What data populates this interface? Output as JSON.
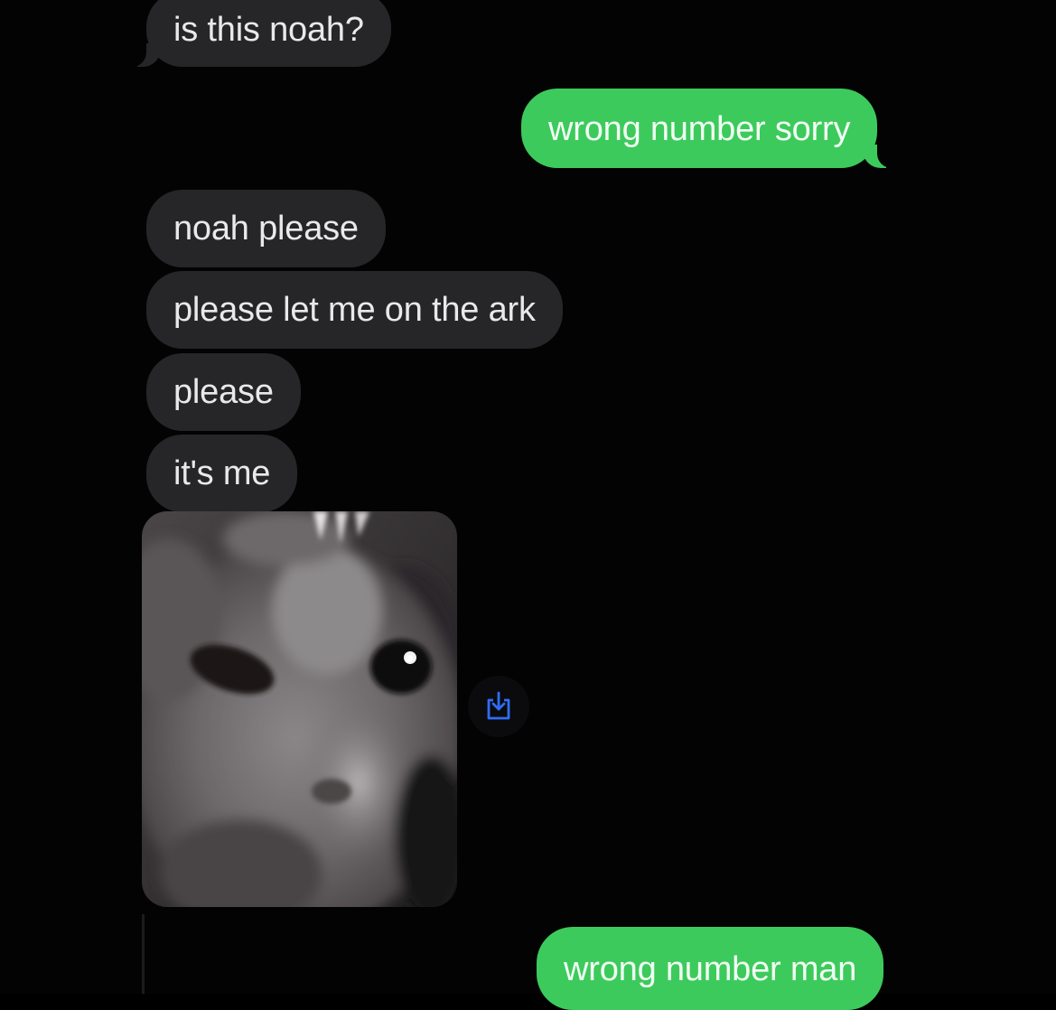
{
  "messages": [
    {
      "side": "incoming",
      "text": "is this noah?"
    },
    {
      "side": "outgoing",
      "text": "wrong number sorry"
    },
    {
      "side": "incoming",
      "text": "noah please"
    },
    {
      "side": "incoming",
      "text": "please let me on the ark"
    },
    {
      "side": "incoming",
      "text": "please"
    },
    {
      "side": "incoming",
      "text": "it's me"
    },
    {
      "side": "incoming",
      "type": "image",
      "subject": "cat close-up photo"
    },
    {
      "side": "outgoing",
      "text": "wrong number man"
    }
  ],
  "colors": {
    "background": "#030303",
    "incoming_bubble": "#262628",
    "outgoing_bubble": "#3dca5c",
    "save_icon": "#2f6df6"
  },
  "icons": {
    "save": "save-download-icon"
  }
}
